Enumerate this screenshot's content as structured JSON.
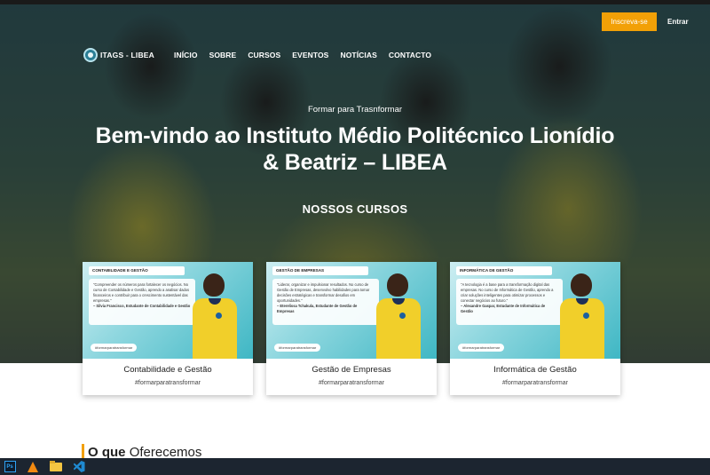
{
  "header": {
    "enroll_label": "Inscreva-se",
    "login_label": "Entrar"
  },
  "nav": {
    "logo_text": "ITAGS - LIBEA",
    "items": [
      {
        "label": "INÍCIO"
      },
      {
        "label": "SOBRE"
      },
      {
        "label": "CURSOS"
      },
      {
        "label": "EVENTOS"
      },
      {
        "label": "NOTÍCIAS"
      },
      {
        "label": "CONTACTO"
      }
    ]
  },
  "hero": {
    "tagline": "Formar para Trasnformar",
    "title_line1": "Bem-vindo ao Instituto Médio Politécnico Lionídio",
    "title_line2": "& Beatriz – LIBEA",
    "courses_heading": "NOSSOS CURSOS"
  },
  "courses": [
    {
      "title": "Contabilidade e Gestão",
      "tag": "#formarparatransformar",
      "image_header": "CONTABILIDADE E GESTÃO",
      "image_quote": "\"Compreender os números para fortalecer os negócios. No curso de Contabilidade e Gestão, aprendo a analisar dados financeiros e contribuir para o crescimento sustentável das empresas.\"",
      "image_author": "– Silvia Francisco, Estudante de Contabilidade e Gestão",
      "image_tag": "#formarparatransformar"
    },
    {
      "title": "Gestão de Empresas",
      "tag": "#formarparatransformar",
      "image_header": "GESTÃO DE EMPRESAS",
      "image_quote": "\"Liderar, organizar e impulsionar resultados. No curso de Gestão de Empresas, desenvolvo habilidades para tomar decisões estratégicas e transformar desafios em oportunidades.\"",
      "image_author": "– Eterelissa Tchakula, Estudante de Gestão de Empresas",
      "image_tag": "#formarparatransformar"
    },
    {
      "title": "Informática de Gestão",
      "tag": "#formarparatransformar",
      "image_header": "INFORMÁTICA DE GESTÃO",
      "image_quote": "\"A tecnologia é a base para a transformação digital das empresas. No curso de Informática de Gestão, aprendo a criar soluções inteligentes para otimizar processos e conectar negócios ao futuro.\"",
      "image_author": "– Alexandre Gaspar, Estudante de Informática de Gestão",
      "image_tag": "#formarparatransformar"
    }
  ],
  "offer": {
    "heading_bold": "O que",
    "heading_rest": "Oferecemos"
  },
  "taskbar": {
    "items": [
      {
        "icon": "photoshop-icon",
        "label": "Ps"
      },
      {
        "icon": "vlc-icon"
      },
      {
        "icon": "folder-icon"
      },
      {
        "icon": "vscode-icon"
      }
    ]
  },
  "colors": {
    "accent": "#f2a007",
    "taskbar": "#1c2530"
  }
}
